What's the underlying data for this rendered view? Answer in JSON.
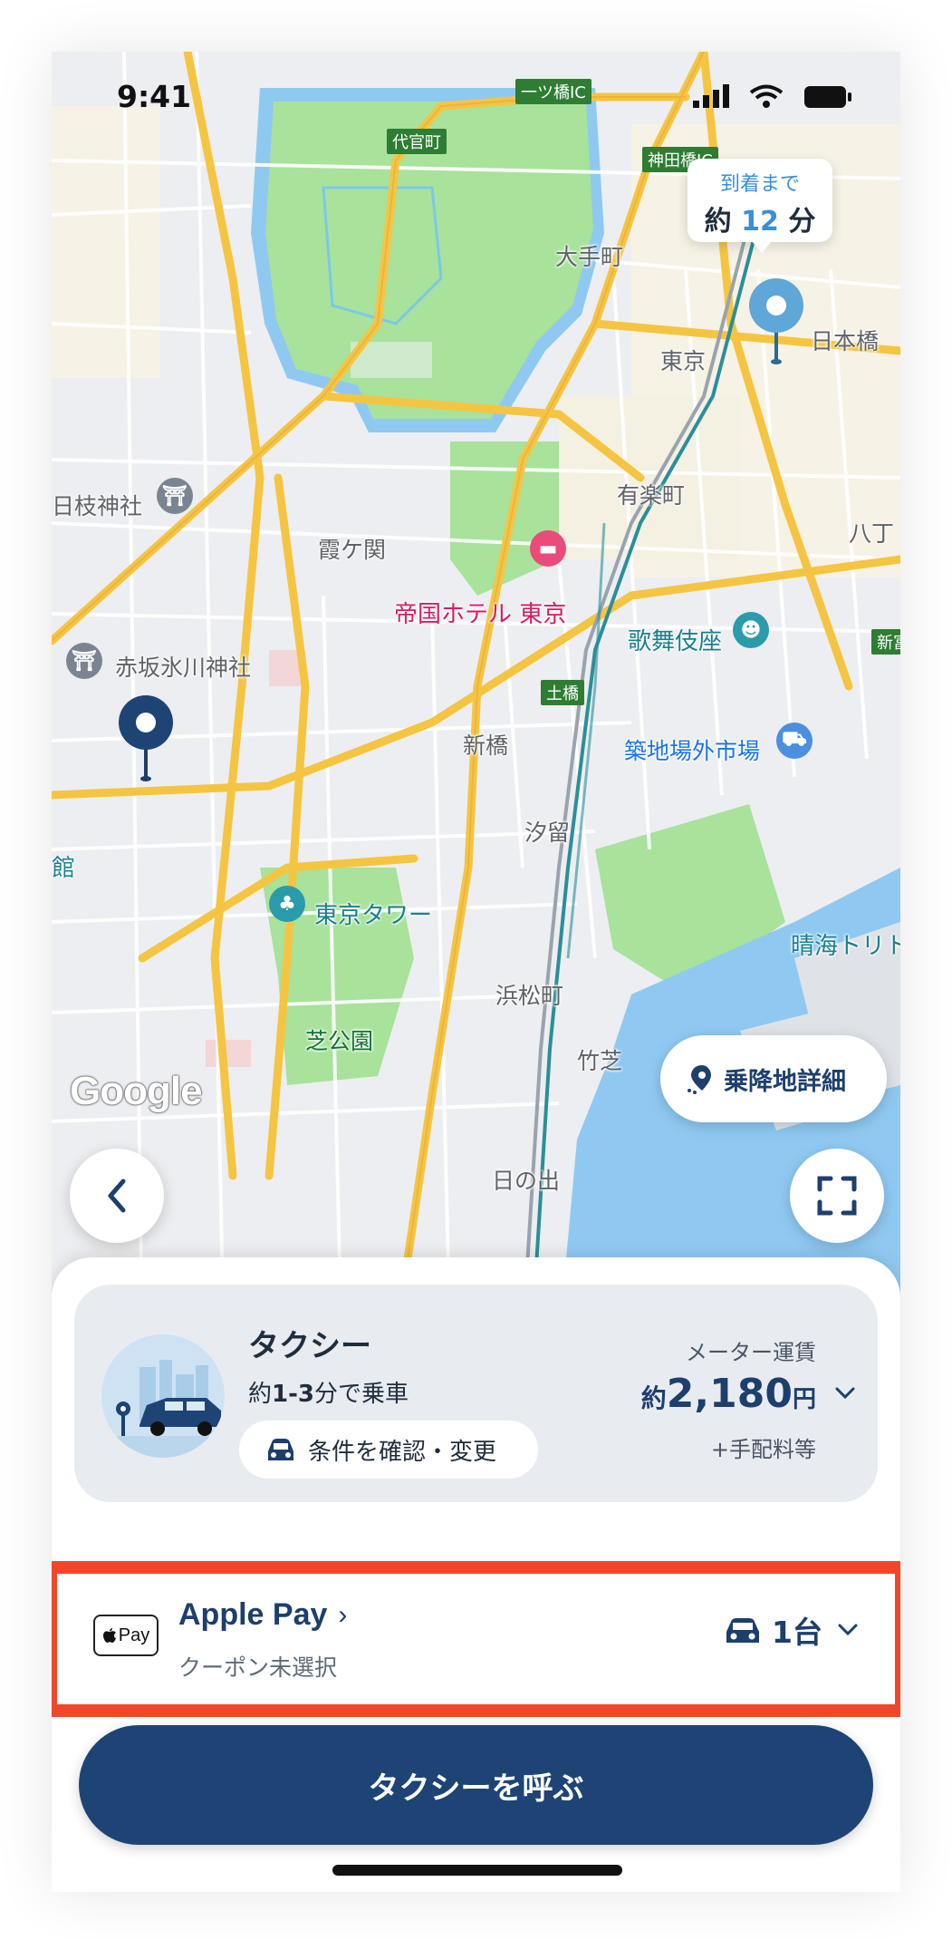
{
  "status_bar": {
    "time": "9:41"
  },
  "eta_bubble": {
    "caption": "到着まで",
    "prefix": "約",
    "minutes": "12",
    "unit": "分"
  },
  "map": {
    "labels": {
      "hitotsubashi_ic": "一ツ橋IC",
      "daikancho": "代官町",
      "kandabashi_ic": "神田橋IC",
      "otemachi": "大手町",
      "tokyo": "東京",
      "nihonbashi": "日本橋",
      "hie_jinja": "日枝神社",
      "yurakucho": "有楽町",
      "kasumigaseki": "霞ケ関",
      "imperial_hotel": "帝国ホテル 東京",
      "kabukiza": "歌舞伎座",
      "akasaka_hikawa": "赤坂氷川神社",
      "dobashi": "土橋",
      "shinbashi": "新橋",
      "tsukiji": "築地場外市場",
      "shiodome": "汐留",
      "tokyo_tower": "東京タワー",
      "harumi": "晴海トリト",
      "hamamatsucho": "浜松町",
      "shibakoen": "芝公園",
      "takeshiba": "竹芝",
      "hinode": "日の出",
      "shintomi": "新富",
      "hatchobori": "八丁",
      "kan": "館"
    },
    "google_logo": "Google",
    "dropoff_detail_label": "乗降地詳細"
  },
  "ride_option": {
    "title": "タクシー",
    "eta_prefix": "約",
    "eta_range": "1-3",
    "eta_suffix": "分で乗車",
    "conditions_label": "条件を確認・変更",
    "fare_label": "メーター運賃",
    "fare_prefix": "約",
    "fare_amount": "2,180",
    "fare_unit": "円",
    "fare_extra": "+手配料等"
  },
  "payment": {
    "badge": "Pay",
    "method": "Apple Pay",
    "coupon_status": "クーポン未選択",
    "vehicle_count": "1台"
  },
  "call_button_label": "タクシーを呼ぶ",
  "colors": {
    "primary_navy": "#1d4475",
    "highlight_border": "#f0472a",
    "accent_blue": "#3a8fd6",
    "park_green": "#a8e29b"
  },
  "icons": {
    "pickup_pin": "map-pin-navy",
    "destination_pin": "map-pin-lightblue",
    "back": "chevron-left-icon",
    "fullscreen": "expand-corners-icon",
    "car": "car-icon",
    "location": "location-pin-dots-icon"
  }
}
